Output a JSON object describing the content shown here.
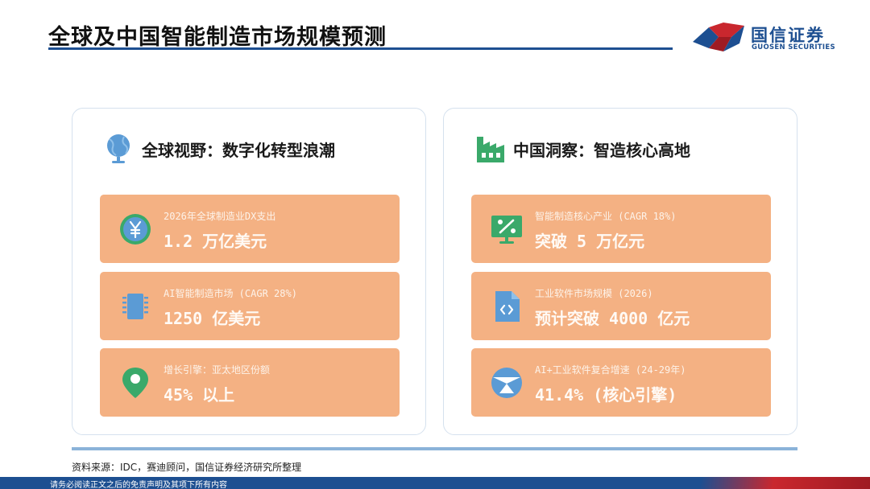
{
  "header": {
    "title": "全球及中国智能制造市场规模预测",
    "logo_cn": "国信证券",
    "logo_en": "GUOSEN SECURITIES"
  },
  "colors": {
    "brand_blue": "#1d4f91",
    "brand_red": "#c9272e",
    "card_bg": "#f4b183",
    "icon_blue": "#5b9bd5",
    "icon_green": "#3aa96a"
  },
  "panels": [
    {
      "title": "全球视野：数字化转型浪潮",
      "icon": "globe-icon",
      "cards": [
        {
          "icon": "yen-coin-icon",
          "label": "2026年全球制造业DX支出",
          "value": "1.2 万亿美元"
        },
        {
          "icon": "chip-icon",
          "label": "AI智能制造市场 (CAGR 28%)",
          "value": "1250 亿美元"
        },
        {
          "icon": "location-pin-icon",
          "label": "增长引擎：亚太地区份额",
          "value": "45% 以上"
        }
      ]
    },
    {
      "title": "中国洞察：智造核心高地",
      "icon": "factory-icon",
      "cards": [
        {
          "icon": "percent-monitor-icon",
          "label": "智能制造核心产业 (CAGR 18%)",
          "value": "突破 5 万亿元"
        },
        {
          "icon": "code-file-icon",
          "label": "工业软件市场规模 (2026)",
          "value": "预计突破 4000 亿元"
        },
        {
          "icon": "compass-icon",
          "label": "AI+工业软件复合增速 (24-29年)",
          "value": "41.4% (核心引擎)"
        }
      ]
    }
  ],
  "footer": {
    "source": "资料来源：IDC，赛迪顾问，国信证券经济研究所整理",
    "disclaimer": "请务必阅读正文之后的免责声明及其项下所有内容"
  }
}
